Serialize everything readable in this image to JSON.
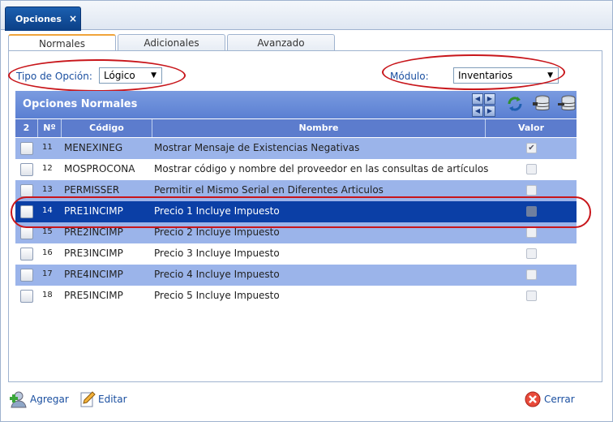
{
  "window": {
    "tab_label": "Opciones",
    "close_glyph": "×"
  },
  "subtabs": [
    "Normales",
    "Adicionales",
    "Avanzado"
  ],
  "filters": {
    "tipo_label": "Tipo de Opción:",
    "tipo_value": "Lógico",
    "modulo_label": "Módulo:",
    "modulo_value": "Inventarios"
  },
  "grid": {
    "title": "Opciones Normales",
    "columns": {
      "sel": "2",
      "num": "Nº",
      "code": "Código",
      "name": "Nombre",
      "value": "Valor"
    },
    "rows": [
      {
        "num": "11",
        "code": "MENEXINEG",
        "name": "Mostrar Mensaje de Existencias Negativas",
        "value": true
      },
      {
        "num": "12",
        "code": "MOSPROCONA",
        "name": "Mostrar código y nombre del proveedor en las consultas de artículos",
        "value": false
      },
      {
        "num": "13",
        "code": "PERMISSER",
        "name": "Permitir el Mismo Serial en Diferentes Articulos",
        "value": false
      },
      {
        "num": "14",
        "code": "PRE1INCIMP",
        "name": "Precio 1 Incluye Impuesto",
        "value": false
      },
      {
        "num": "15",
        "code": "PRE2INCIMP",
        "name": "Precio 2 Incluye Impuesto",
        "value": false
      },
      {
        "num": "16",
        "code": "PRE3INCIMP",
        "name": "Precio 3 Incluye Impuesto",
        "value": false
      },
      {
        "num": "17",
        "code": "PRE4INCIMP",
        "name": "Precio 4 Incluye Impuesto",
        "value": false
      },
      {
        "num": "18",
        "code": "PRE5INCIMP",
        "name": "Precio 5 Incluye Impuesto",
        "value": false
      }
    ],
    "check_glyph": "✔"
  },
  "footer": {
    "add_label": "Agregar",
    "edit_label": "Editar",
    "close_label": "Cerrar"
  },
  "colors": {
    "accent": "#0b3fa6",
    "header": "#5c7ccd",
    "alt_row": "#9bb4ea",
    "highlight": "#c8161b"
  }
}
